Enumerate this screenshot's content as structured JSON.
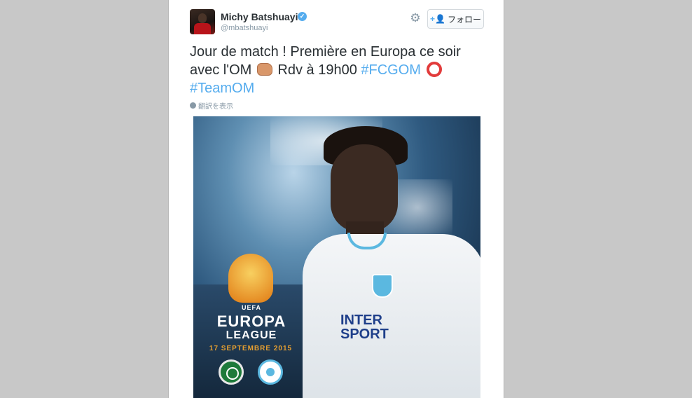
{
  "tweet": {
    "user_name": "Michy Batshuayi",
    "user_handle": "@mbatshuayi",
    "follow_label": "フォロー",
    "text_parts": {
      "line1": "Jour de match ! Première en Europa ce soir",
      "line2_start": "avec l'OM ",
      "line2_mid": " Rdv à 19h00 ",
      "hashtag1": "#FCGOM",
      "hashtag2": "#TeamOM"
    },
    "translate_label": "翻訳を表示"
  },
  "media": {
    "sponsor_line1": "INTER",
    "sponsor_line2": "SPORT",
    "uefa_label": "UEFA",
    "europa_label": "EUROPA",
    "league_label": "LEAGUE",
    "date_label": "17 SEPTEMBRE 2015"
  },
  "colors": {
    "hashtag": "#55acee",
    "verified": "#55acee",
    "page_bg": "#c8c8c8"
  },
  "icons": {
    "verified": "verified-badge-icon",
    "gear": "gear-icon",
    "follow": "add-user-icon",
    "globe": "globe-icon",
    "fist_emoji": "fist-emoji-icon",
    "circle_emoji": "red-circle-emoji-icon"
  }
}
